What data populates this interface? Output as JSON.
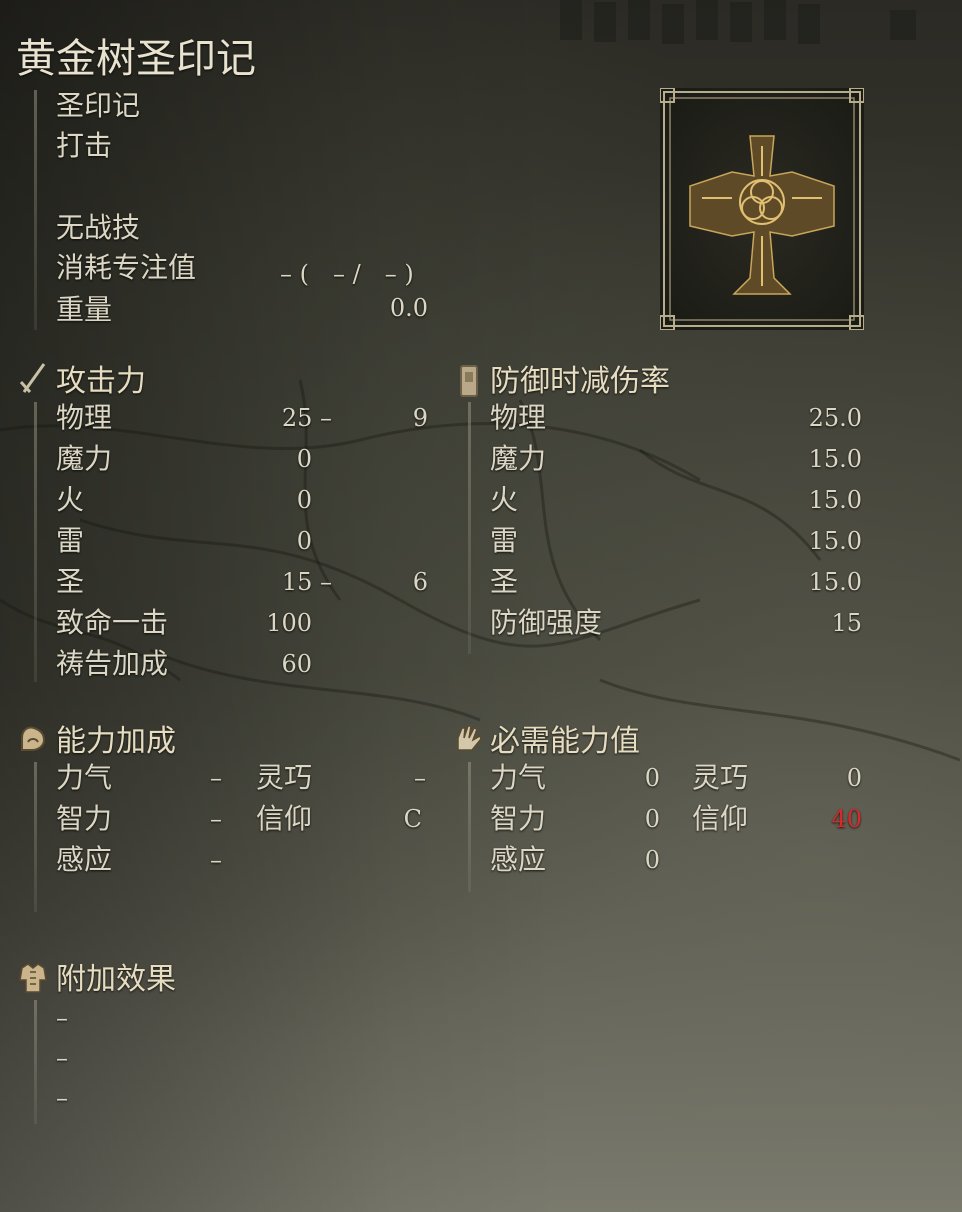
{
  "item": {
    "name": "黄金树圣印记",
    "type": "圣印记",
    "attack_type": "打击",
    "skill": "无战技",
    "fp_label": "消耗专注值",
    "fp_value": "– (　– /　– )",
    "weight_label": "重量",
    "weight_value": "0.0",
    "image_icon": "golden-order-seal-icon"
  },
  "attack": {
    "title": "攻击力",
    "rows": [
      {
        "label": "物理",
        "a": "25 –",
        "b": "9"
      },
      {
        "label": "魔力",
        "a": "0",
        "b": ""
      },
      {
        "label": "火",
        "a": "0",
        "b": ""
      },
      {
        "label": "雷",
        "a": "0",
        "b": ""
      },
      {
        "label": "圣",
        "a": "15 –",
        "b": "6"
      },
      {
        "label": "致命一击",
        "a": "100",
        "b": ""
      },
      {
        "label": "祷告加成",
        "a": "60",
        "b": ""
      }
    ]
  },
  "guard": {
    "title": "防御时减伤率",
    "rows": [
      {
        "label": "物理",
        "value": "25.0"
      },
      {
        "label": "魔力",
        "value": "15.0"
      },
      {
        "label": "火",
        "value": "15.0"
      },
      {
        "label": "雷",
        "value": "15.0"
      },
      {
        "label": "圣",
        "value": "15.0"
      },
      {
        "label": "防御强度",
        "value": "15"
      }
    ]
  },
  "scaling": {
    "title": "能力加成",
    "str_label": "力气",
    "str_value": "–",
    "dex_label": "灵巧",
    "dex_value": "–",
    "int_label": "智力",
    "int_value": "–",
    "fai_label": "信仰",
    "fai_value": "C",
    "arc_label": "感应",
    "arc_value": "–"
  },
  "requirements": {
    "title": "必需能力值",
    "str_label": "力气",
    "str_value": "0",
    "dex_label": "灵巧",
    "dex_value": "0",
    "int_label": "智力",
    "int_value": "0",
    "fai_label": "信仰",
    "fai_value": "40",
    "arc_label": "感应",
    "arc_value": "0",
    "warning_color": "#d42a2a"
  },
  "effects": {
    "title": "附加效果",
    "items": [
      "–",
      "–",
      "–"
    ]
  }
}
